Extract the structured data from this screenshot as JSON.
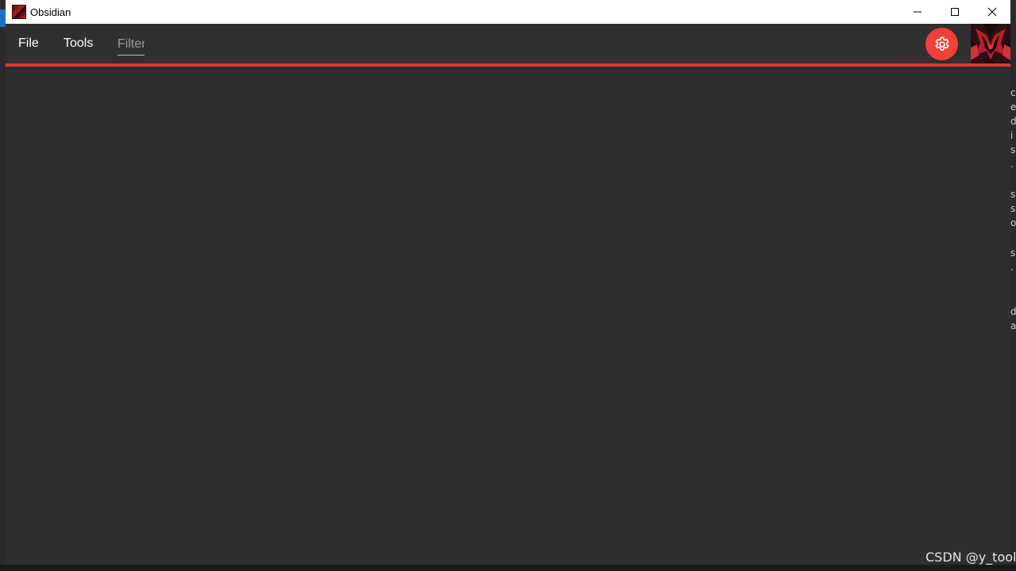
{
  "window": {
    "title": "Obsidian",
    "app_icon": "obsidian-app-icon"
  },
  "window_controls": {
    "minimize_icon": "minimize-icon",
    "maximize_icon": "maximize-icon",
    "close_icon": "close-icon"
  },
  "menu": {
    "file_label": "File",
    "tools_label": "Tools"
  },
  "filter": {
    "placeholder": "Filter",
    "value": ""
  },
  "settings": {
    "icon": "gear-icon"
  },
  "avatar": {
    "icon": "user-avatar-image"
  },
  "colors": {
    "accent": "#e0362f",
    "fab": "#f0403a",
    "appbar_bg": "#303030",
    "content_bg": "#2f2f2f"
  },
  "watermark": {
    "text": "CSDN @y_tool"
  }
}
